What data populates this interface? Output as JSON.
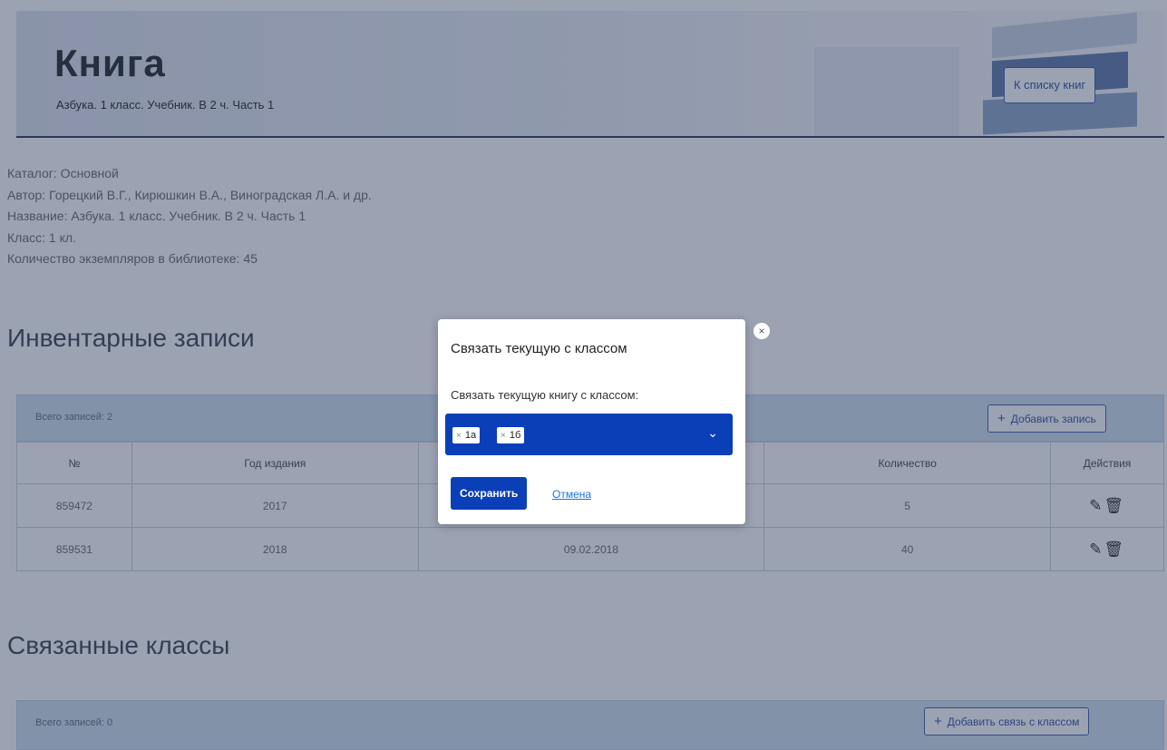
{
  "header": {
    "title": "Книга",
    "subtitle": "Азбука. 1 класс. Учебник. В 2 ч. Часть 1",
    "back_button": "К списку книг"
  },
  "meta": {
    "catalog": "Каталог: Основной",
    "author": "Автор: Горецкий В.Г., Кирюшкин В.А., Виноградская Л.А. и др.",
    "name": "Название: Азбука. 1 класс. Учебник. В 2 ч. Часть 1",
    "grade": "Класс: 1 кл.",
    "copies": "Количество экземпляров в библиотеке: 45"
  },
  "inventory": {
    "title": "Инвентарные записи",
    "count_label": "Всего записей: 2",
    "add_button": "Добавить запись",
    "columns": [
      "№",
      "Год издания",
      "",
      "Количество",
      "Действия"
    ],
    "rows": [
      {
        "num": "859472",
        "year": "2017",
        "date": "",
        "qty": "5"
      },
      {
        "num": "859531",
        "year": "2018",
        "date": "09.02.2018",
        "qty": "40"
      }
    ]
  },
  "linked_classes": {
    "title": "Связанные классы",
    "count_label": "Всего записей: 0",
    "add_button": "Добавить связь с классом"
  },
  "modal": {
    "title": "Связать текущую с классом",
    "label": "Связать текущую книгу с классом:",
    "selected": [
      "1а",
      "1б"
    ],
    "save_button": "Сохранить",
    "cancel_link": "Отмена"
  },
  "icons": {
    "edit": "pencil-icon",
    "delete": "trash-icon",
    "close": "close-icon",
    "plus": "plus-icon",
    "chevron": "chevron-down-icon"
  },
  "colors": {
    "accent": "#0b3fb8",
    "panel_header": "#cfe0ee",
    "overlay": "rgba(45,60,95,0.48)"
  }
}
